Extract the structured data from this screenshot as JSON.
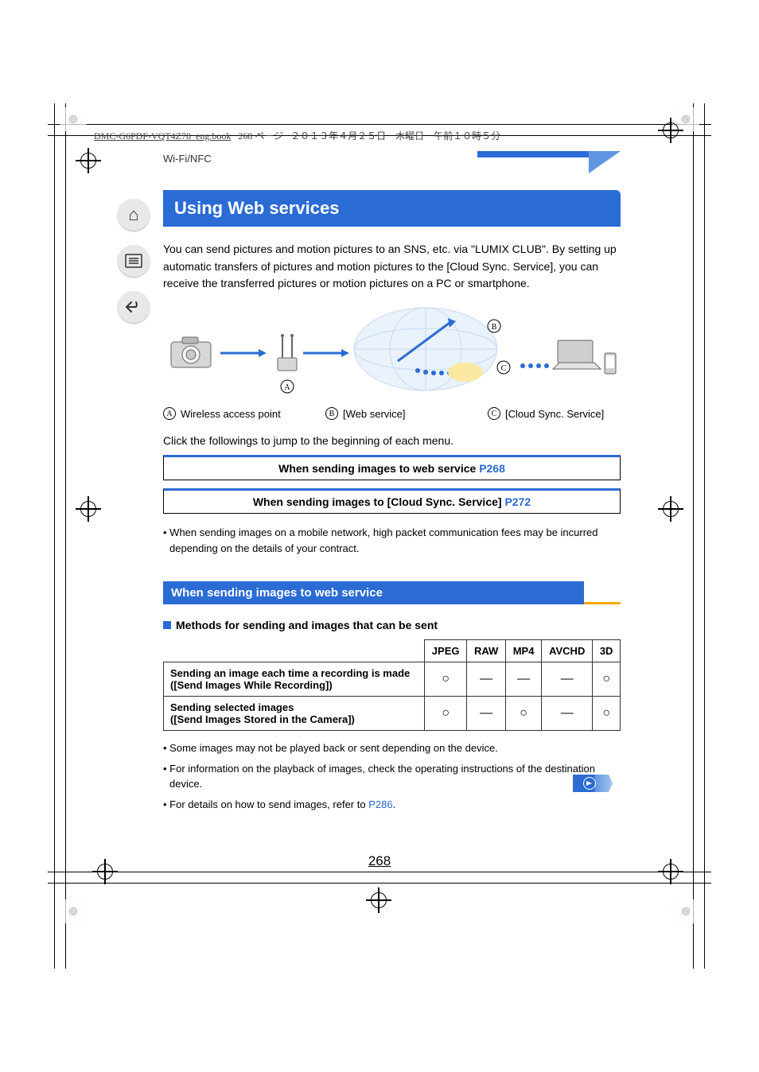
{
  "header_strip": {
    "filename": "DMC-G6PDF-VQT4Z78_eng.book",
    "page_word": "268 ページ",
    "date": "２０１３年４月２５日　木曜日　午前１０時５分"
  },
  "breadcrumb": "Wi-Fi/NFC",
  "title": "Using Web services",
  "intro": "You can send pictures and motion pictures to an SNS, etc. via \"LUMIX CLUB\". By setting up automatic transfers of pictures and motion pictures to the [Cloud Sync. Service], you can receive the transferred pictures or motion pictures on a PC or smartphone.",
  "labels": {
    "a": {
      "letter": "A",
      "text": "Wireless access point"
    },
    "b": {
      "letter": "B",
      "text": "[Web service]"
    },
    "c": {
      "letter": "C",
      "text": "[Cloud Sync. Service]"
    }
  },
  "click_text": "Click the followings to jump to the beginning of each menu.",
  "linkbox1": {
    "text": "When sending images to web service",
    "page": "P268"
  },
  "linkbox2": {
    "text": "When sending images to [Cloud Sync. Service]",
    "page": "P272"
  },
  "note_mobile": "When sending images on a mobile network, high packet communication fees may be incurred depending on the details of your contract.",
  "subheading": "When sending images to web service",
  "methods_heading": "Methods for sending and images that can be sent",
  "table": {
    "headers": [
      "JPEG",
      "RAW",
      "MP4",
      "AVCHD",
      "3D"
    ],
    "rows": [
      {
        "label": "Sending an image each time a recording is made\n([Send Images While Recording])",
        "cells": [
          "○",
          "—",
          "—",
          "—",
          "○"
        ]
      },
      {
        "label": "Sending selected images\n([Send Images Stored in the Camera])",
        "cells": [
          "○",
          "—",
          "○",
          "—",
          "○"
        ]
      }
    ]
  },
  "notes": [
    "Some images may not be played back or sent depending on the device.",
    "For information on the playback of images, check the operating instructions of the destination device."
  ],
  "note_link": {
    "prefix": "For details on how to send images, refer to ",
    "page": "P286",
    "suffix": "."
  },
  "page_number": "268"
}
